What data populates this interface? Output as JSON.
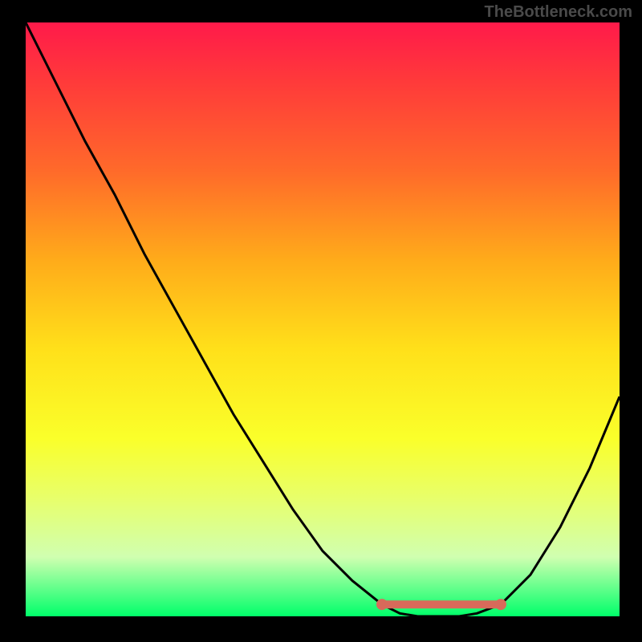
{
  "watermark": "TheBottleneck.com",
  "chart_data": {
    "type": "line",
    "title": "",
    "xlabel": "",
    "ylabel": "",
    "x": [
      0.0,
      0.05,
      0.1,
      0.15,
      0.2,
      0.25,
      0.3,
      0.35,
      0.4,
      0.45,
      0.5,
      0.55,
      0.6,
      0.63,
      0.66,
      0.7,
      0.73,
      0.76,
      0.8,
      0.85,
      0.9,
      0.95,
      1.0
    ],
    "y": [
      1.0,
      0.9,
      0.8,
      0.71,
      0.61,
      0.52,
      0.43,
      0.34,
      0.26,
      0.18,
      0.11,
      0.06,
      0.02,
      0.005,
      0.0,
      0.0,
      0.0,
      0.005,
      0.02,
      0.07,
      0.15,
      0.25,
      0.37
    ],
    "xlim": [
      0,
      1
    ],
    "ylim": [
      0,
      1
    ],
    "annotations": {
      "highlight_segment_x": [
        0.6,
        0.8
      ],
      "highlight_color": "#d86a5a"
    },
    "background_gradient": {
      "top": "#ff1a4a",
      "bottom": "#00ff6a"
    }
  }
}
